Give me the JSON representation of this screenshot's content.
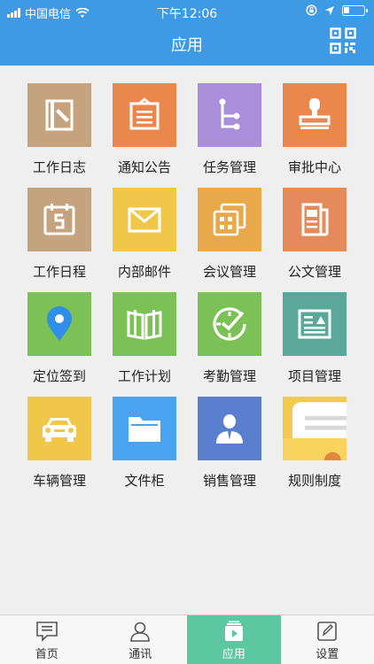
{
  "status_bar": {
    "carrier": "中国电信",
    "time": "下午12:06"
  },
  "nav": {
    "title": "应用"
  },
  "apps": [
    {
      "label": "工作日志",
      "color": "#c4a37e",
      "icon": "journal-icon"
    },
    {
      "label": "通知公告",
      "color": "#e9874d",
      "icon": "notice-board-icon"
    },
    {
      "label": "任务管理",
      "color": "#a98ed9",
      "icon": "task-tree-icon"
    },
    {
      "label": "审批中心",
      "color": "#e9874d",
      "icon": "stamp-icon"
    },
    {
      "label": "工作日程",
      "color": "#c4a37e",
      "icon": "calendar-icon"
    },
    {
      "label": "内部邮件",
      "color": "#f1c74a",
      "icon": "mail-icon"
    },
    {
      "label": "会议管理",
      "color": "#e9a94a",
      "icon": "meeting-icon"
    },
    {
      "label": "公文管理",
      "color": "#e58a5a",
      "icon": "document-icon"
    },
    {
      "label": "定位签到",
      "color": "#7bc155",
      "icon": "location-pin-icon"
    },
    {
      "label": "工作计划",
      "color": "#7bc155",
      "icon": "book-icon"
    },
    {
      "label": "考勤管理",
      "color": "#7bc155",
      "icon": "clock-check-icon"
    },
    {
      "label": "项目管理",
      "color": "#5aa89a",
      "icon": "project-icon"
    },
    {
      "label": "车辆管理",
      "color": "#f1c74a",
      "icon": "car-icon"
    },
    {
      "label": "文件柜",
      "color": "#4aa3f0",
      "icon": "folder-icon"
    },
    {
      "label": "销售管理",
      "color": "#5b7fcf",
      "icon": "salesperson-icon"
    },
    {
      "label": "规则制度",
      "color": "#f3c94f",
      "icon": "rules-card-icon"
    }
  ],
  "tabs": [
    {
      "label": "首页",
      "icon": "chat-home-icon",
      "active": false
    },
    {
      "label": "通讯",
      "icon": "contact-icon",
      "active": false
    },
    {
      "label": "应用",
      "icon": "apps-icon",
      "active": true
    },
    {
      "label": "设置",
      "icon": "edit-settings-icon",
      "active": false
    }
  ]
}
